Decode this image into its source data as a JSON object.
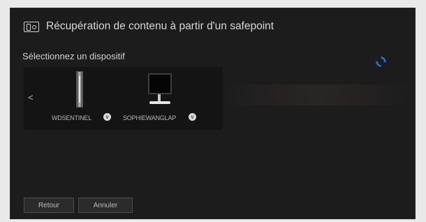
{
  "dialog": {
    "title": "Récupération de contenu à partir d'un safepoint",
    "subtitle": "Sélectionnez un dispositif",
    "nav_prev": "<",
    "devices": [
      {
        "label": "WDSENTINEL",
        "icon": "nas-tower-icon",
        "chevron": "v"
      },
      {
        "label": "SOPHIEWANGLAP",
        "icon": "monitor-icon",
        "chevron": "v"
      }
    ],
    "buttons": {
      "back": "Retour",
      "cancel": "Annuler"
    }
  },
  "colors": {
    "background": "#1c1c1c",
    "accent_spinner": "#2a6fd6"
  }
}
